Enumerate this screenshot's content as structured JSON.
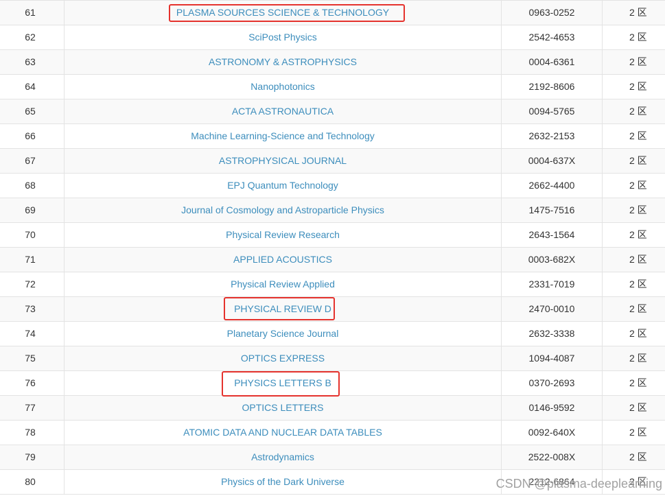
{
  "table": {
    "rows": [
      {
        "rank": "61",
        "journal": "PLASMA SOURCES SCIENCE & TECHNOLOGY",
        "issn": "0963-0252",
        "zone": "2 区"
      },
      {
        "rank": "62",
        "journal": "SciPost Physics",
        "issn": "2542-4653",
        "zone": "2 区"
      },
      {
        "rank": "63",
        "journal": "ASTRONOMY & ASTROPHYSICS",
        "issn": "0004-6361",
        "zone": "2 区"
      },
      {
        "rank": "64",
        "journal": "Nanophotonics",
        "issn": "2192-8606",
        "zone": "2 区"
      },
      {
        "rank": "65",
        "journal": "ACTA ASTRONAUTICA",
        "issn": "0094-5765",
        "zone": "2 区"
      },
      {
        "rank": "66",
        "journal": "Machine Learning-Science and Technology",
        "issn": "2632-2153",
        "zone": "2 区"
      },
      {
        "rank": "67",
        "journal": "ASTROPHYSICAL JOURNAL",
        "issn": "0004-637X",
        "zone": "2 区"
      },
      {
        "rank": "68",
        "journal": "EPJ Quantum Technology",
        "issn": "2662-4400",
        "zone": "2 区"
      },
      {
        "rank": "69",
        "journal": "Journal of Cosmology and Astroparticle Physics",
        "issn": "1475-7516",
        "zone": "2 区"
      },
      {
        "rank": "70",
        "journal": "Physical Review Research",
        "issn": "2643-1564",
        "zone": "2 区"
      },
      {
        "rank": "71",
        "journal": "APPLIED ACOUSTICS",
        "issn": "0003-682X",
        "zone": "2 区"
      },
      {
        "rank": "72",
        "journal": "Physical Review Applied",
        "issn": "2331-7019",
        "zone": "2 区"
      },
      {
        "rank": "73",
        "journal": "PHYSICAL REVIEW D",
        "issn": "2470-0010",
        "zone": "2 区"
      },
      {
        "rank": "74",
        "journal": "Planetary Science Journal",
        "issn": "2632-3338",
        "zone": "2 区"
      },
      {
        "rank": "75",
        "journal": "OPTICS EXPRESS",
        "issn": "1094-4087",
        "zone": "2 区"
      },
      {
        "rank": "76",
        "journal": "PHYSICS LETTERS B",
        "issn": "0370-2693",
        "zone": "2 区"
      },
      {
        "rank": "77",
        "journal": "OPTICS LETTERS",
        "issn": "0146-9592",
        "zone": "2 区"
      },
      {
        "rank": "78",
        "journal": "ATOMIC DATA AND NUCLEAR DATA TABLES",
        "issn": "0092-640X",
        "zone": "2 区"
      },
      {
        "rank": "79",
        "journal": "Astrodynamics",
        "issn": "2522-008X",
        "zone": "2 区"
      },
      {
        "rank": "80",
        "journal": "Physics of the Dark Universe",
        "issn": "2212-6864",
        "zone": "2 区"
      }
    ]
  },
  "watermark": {
    "text": "CSDN @plasma-deeplearning"
  },
  "colors": {
    "link": "#3c8dbc",
    "text": "#333333",
    "stripe": "#f9f9f9",
    "border": "#e3e3e3",
    "annotation": "#e5322d",
    "watermark": "#8a8a8a"
  }
}
